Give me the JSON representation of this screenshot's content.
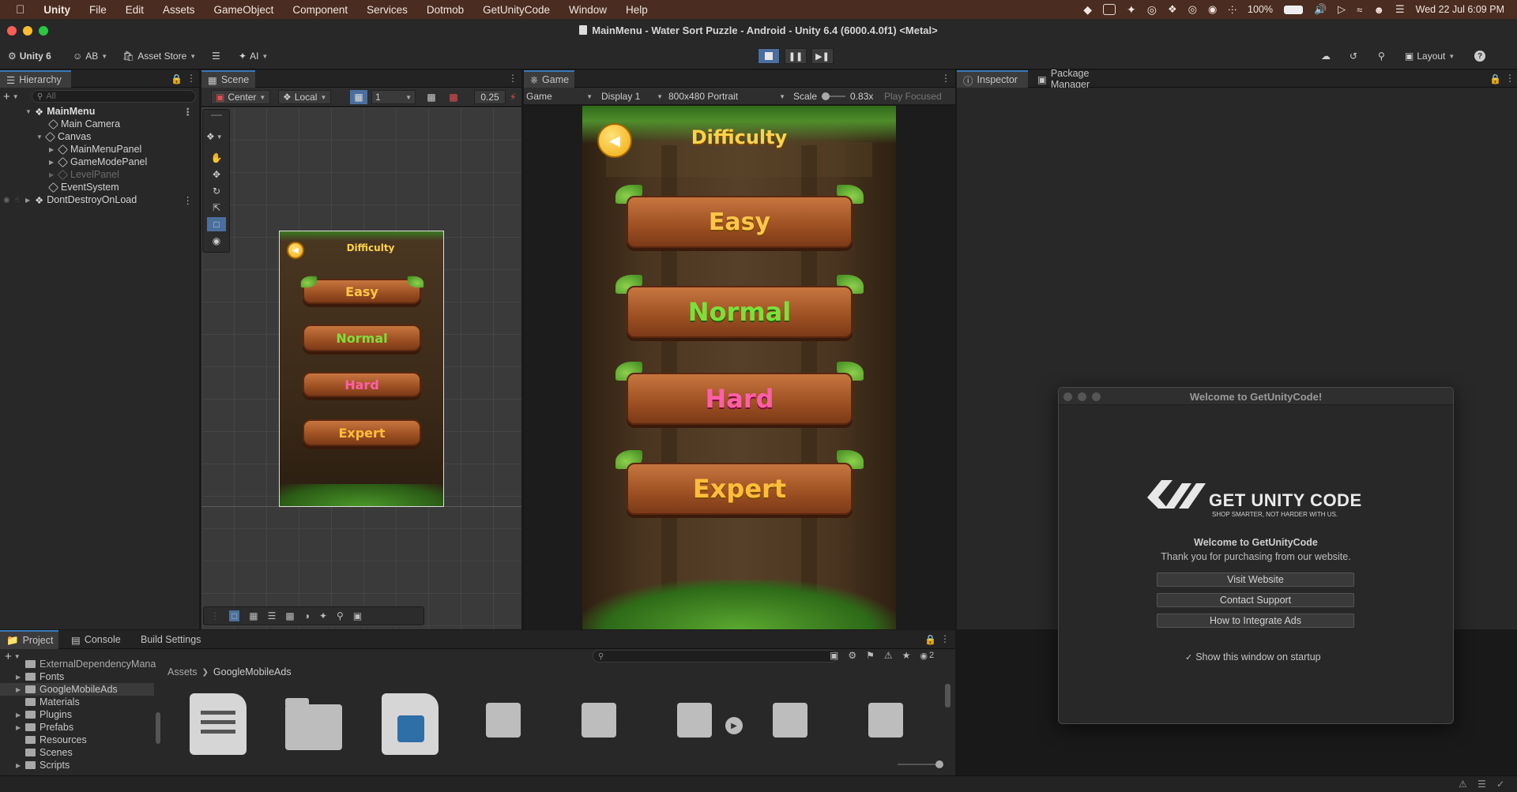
{
  "menubar": {
    "app": "Unity",
    "items": [
      "File",
      "Edit",
      "Assets",
      "GameObject",
      "Component",
      "Services",
      "Dotmob",
      "GetUnityCode",
      "Window",
      "Help"
    ],
    "battery": "100%",
    "datetime": "Wed 22 Jul  6:09 PM"
  },
  "window": {
    "title": "MainMenu - Water Sort Puzzle - Android - Unity 6.4 (6000.4.0f1) <Metal>"
  },
  "toolbar": {
    "unity_version": "Unity 6",
    "account": "AB",
    "asset_store": "Asset Store",
    "ai": "AI",
    "layout": "Layout"
  },
  "hierarchy": {
    "tab": "Hierarchy",
    "search_placeholder": "All",
    "items": [
      {
        "label": "MainMenu"
      },
      {
        "label": "Main Camera"
      },
      {
        "label": "Canvas"
      },
      {
        "label": "MainMenuPanel"
      },
      {
        "label": "GameModePanel"
      },
      {
        "label": "LevelPanel"
      },
      {
        "label": "EventSystem"
      },
      {
        "label": "DontDestroyOnLoad"
      }
    ]
  },
  "scene": {
    "tab": "Scene",
    "pivot": "Center",
    "space": "Local",
    "grid_value": "1",
    "snap_value": "0.25"
  },
  "game": {
    "tab": "Game",
    "mode": "Game",
    "display": "Display 1",
    "resolution": "800x480 Portrait",
    "scale_label": "Scale",
    "scale_value": "0.83x",
    "play_focused": "Play Focused"
  },
  "puzzle_ui": {
    "title": "Difficulty",
    "buttons": [
      "Easy",
      "Normal",
      "Hard",
      "Expert"
    ],
    "colors": {
      "easy": "#ffc64a",
      "normal": "#7be03a",
      "hard": "#ff5fa8",
      "expert": "#ffbe3a"
    }
  },
  "inspector": {
    "tab": "Inspector",
    "package_tab": "Package Manager"
  },
  "dialog": {
    "title": "Welcome to GetUnityCode!",
    "logo_text": "GET UNITY CODE",
    "logo_tagline": "SHOP SMARTER, NOT HARDER WITH US.",
    "welcome": "Welcome to GetUnityCode",
    "thanks": "Thank you for purchasing from our website.",
    "buttons": [
      "Visit Website",
      "Contact Support",
      "How to Integrate Ads"
    ],
    "checkbox_label": "Show this window on startup"
  },
  "project": {
    "tabs": [
      "Project",
      "Console",
      "Build Settings"
    ],
    "tree": [
      "ExternalDependencyMana",
      "Fonts",
      "GoogleMobileAds",
      "Materials",
      "Plugins",
      "Prefabs",
      "Resources",
      "Scenes",
      "Scripts"
    ],
    "breadcrumb": [
      "Assets",
      "GoogleMobileAds"
    ],
    "hidden_count": "2"
  }
}
